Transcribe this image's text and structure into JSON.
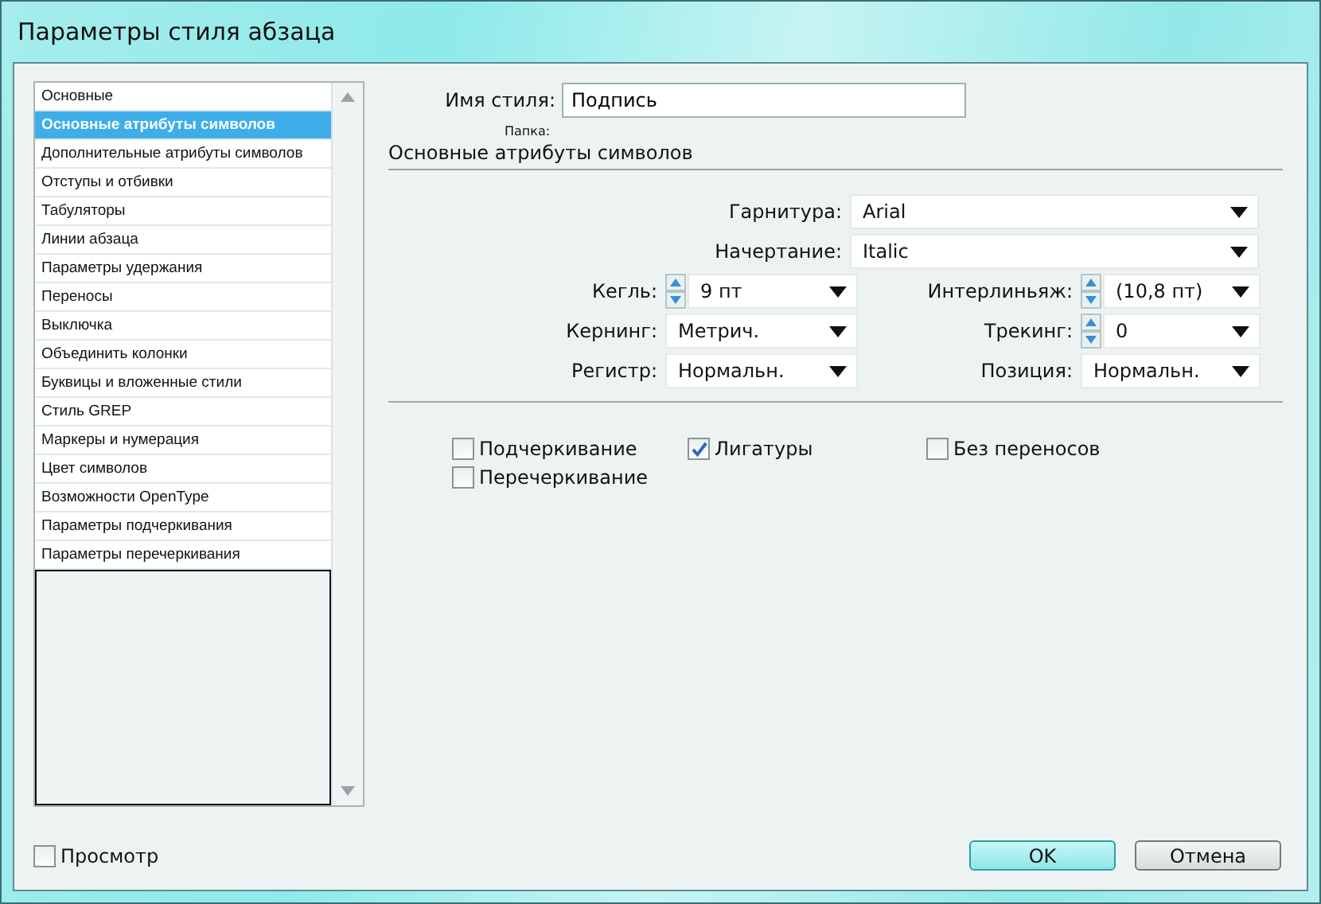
{
  "window": {
    "title": "Параметры стиля абзаца"
  },
  "sidebar": {
    "items": [
      {
        "label": "Основные",
        "selected": false
      },
      {
        "label": "Основные атрибуты символов",
        "selected": true
      },
      {
        "label": "Дополнительные атрибуты символов",
        "selected": false
      },
      {
        "label": "Отступы и отбивки",
        "selected": false
      },
      {
        "label": "Табуляторы",
        "selected": false
      },
      {
        "label": "Линии абзаца",
        "selected": false
      },
      {
        "label": "Параметры удержания",
        "selected": false
      },
      {
        "label": "Переносы",
        "selected": false
      },
      {
        "label": "Выключка",
        "selected": false
      },
      {
        "label": "Объединить колонки",
        "selected": false
      },
      {
        "label": "Буквицы и вложенные стили",
        "selected": false
      },
      {
        "label": "Стиль GREP",
        "selected": false
      },
      {
        "label": "Маркеры и нумерация",
        "selected": false
      },
      {
        "label": "Цвет символов",
        "selected": false
      },
      {
        "label": "Возможности OpenType",
        "selected": false
      },
      {
        "label": "Параметры подчеркивания",
        "selected": false
      },
      {
        "label": "Параметры перечеркивания",
        "selected": false
      }
    ]
  },
  "style_name": {
    "label": "Имя стиля:",
    "value": "Подпись"
  },
  "folder_label": "Папка:",
  "section_title": "Основные атрибуты символов",
  "wide_fields": [
    {
      "label": "Гарнитура:",
      "value": "Arial",
      "kind": "select"
    },
    {
      "label": "Начертание:",
      "value": "Italic",
      "kind": "select"
    }
  ],
  "field_pairs": [
    [
      {
        "label": "Кегль:",
        "value": "9 пт",
        "kind": "spin"
      },
      {
        "label": "Интерлиньяж:",
        "value": "(10,8 пт)",
        "kind": "spin"
      }
    ],
    [
      {
        "label": "Кернинг:",
        "value": "Метрич.",
        "kind": "select"
      },
      {
        "label": "Трекинг:",
        "value": "0",
        "kind": "spin"
      }
    ],
    [
      {
        "label": "Регистр:",
        "value": "Нормальн.",
        "kind": "select"
      },
      {
        "label": "Позиция:",
        "value": "Нормальн.",
        "kind": "select"
      }
    ]
  ],
  "checkboxes": [
    {
      "label": "Подчеркивание",
      "checked": false
    },
    {
      "label": "Лигатуры",
      "checked": true
    },
    {
      "label": "Без переносов",
      "checked": false
    },
    {
      "label": "Перечеркивание",
      "checked": false
    }
  ],
  "preview": {
    "label": "Просмотр",
    "checked": false
  },
  "buttons": [
    {
      "label": "OK",
      "kind": "default"
    },
    {
      "label": "Отмена",
      "kind": "normal"
    }
  ]
}
